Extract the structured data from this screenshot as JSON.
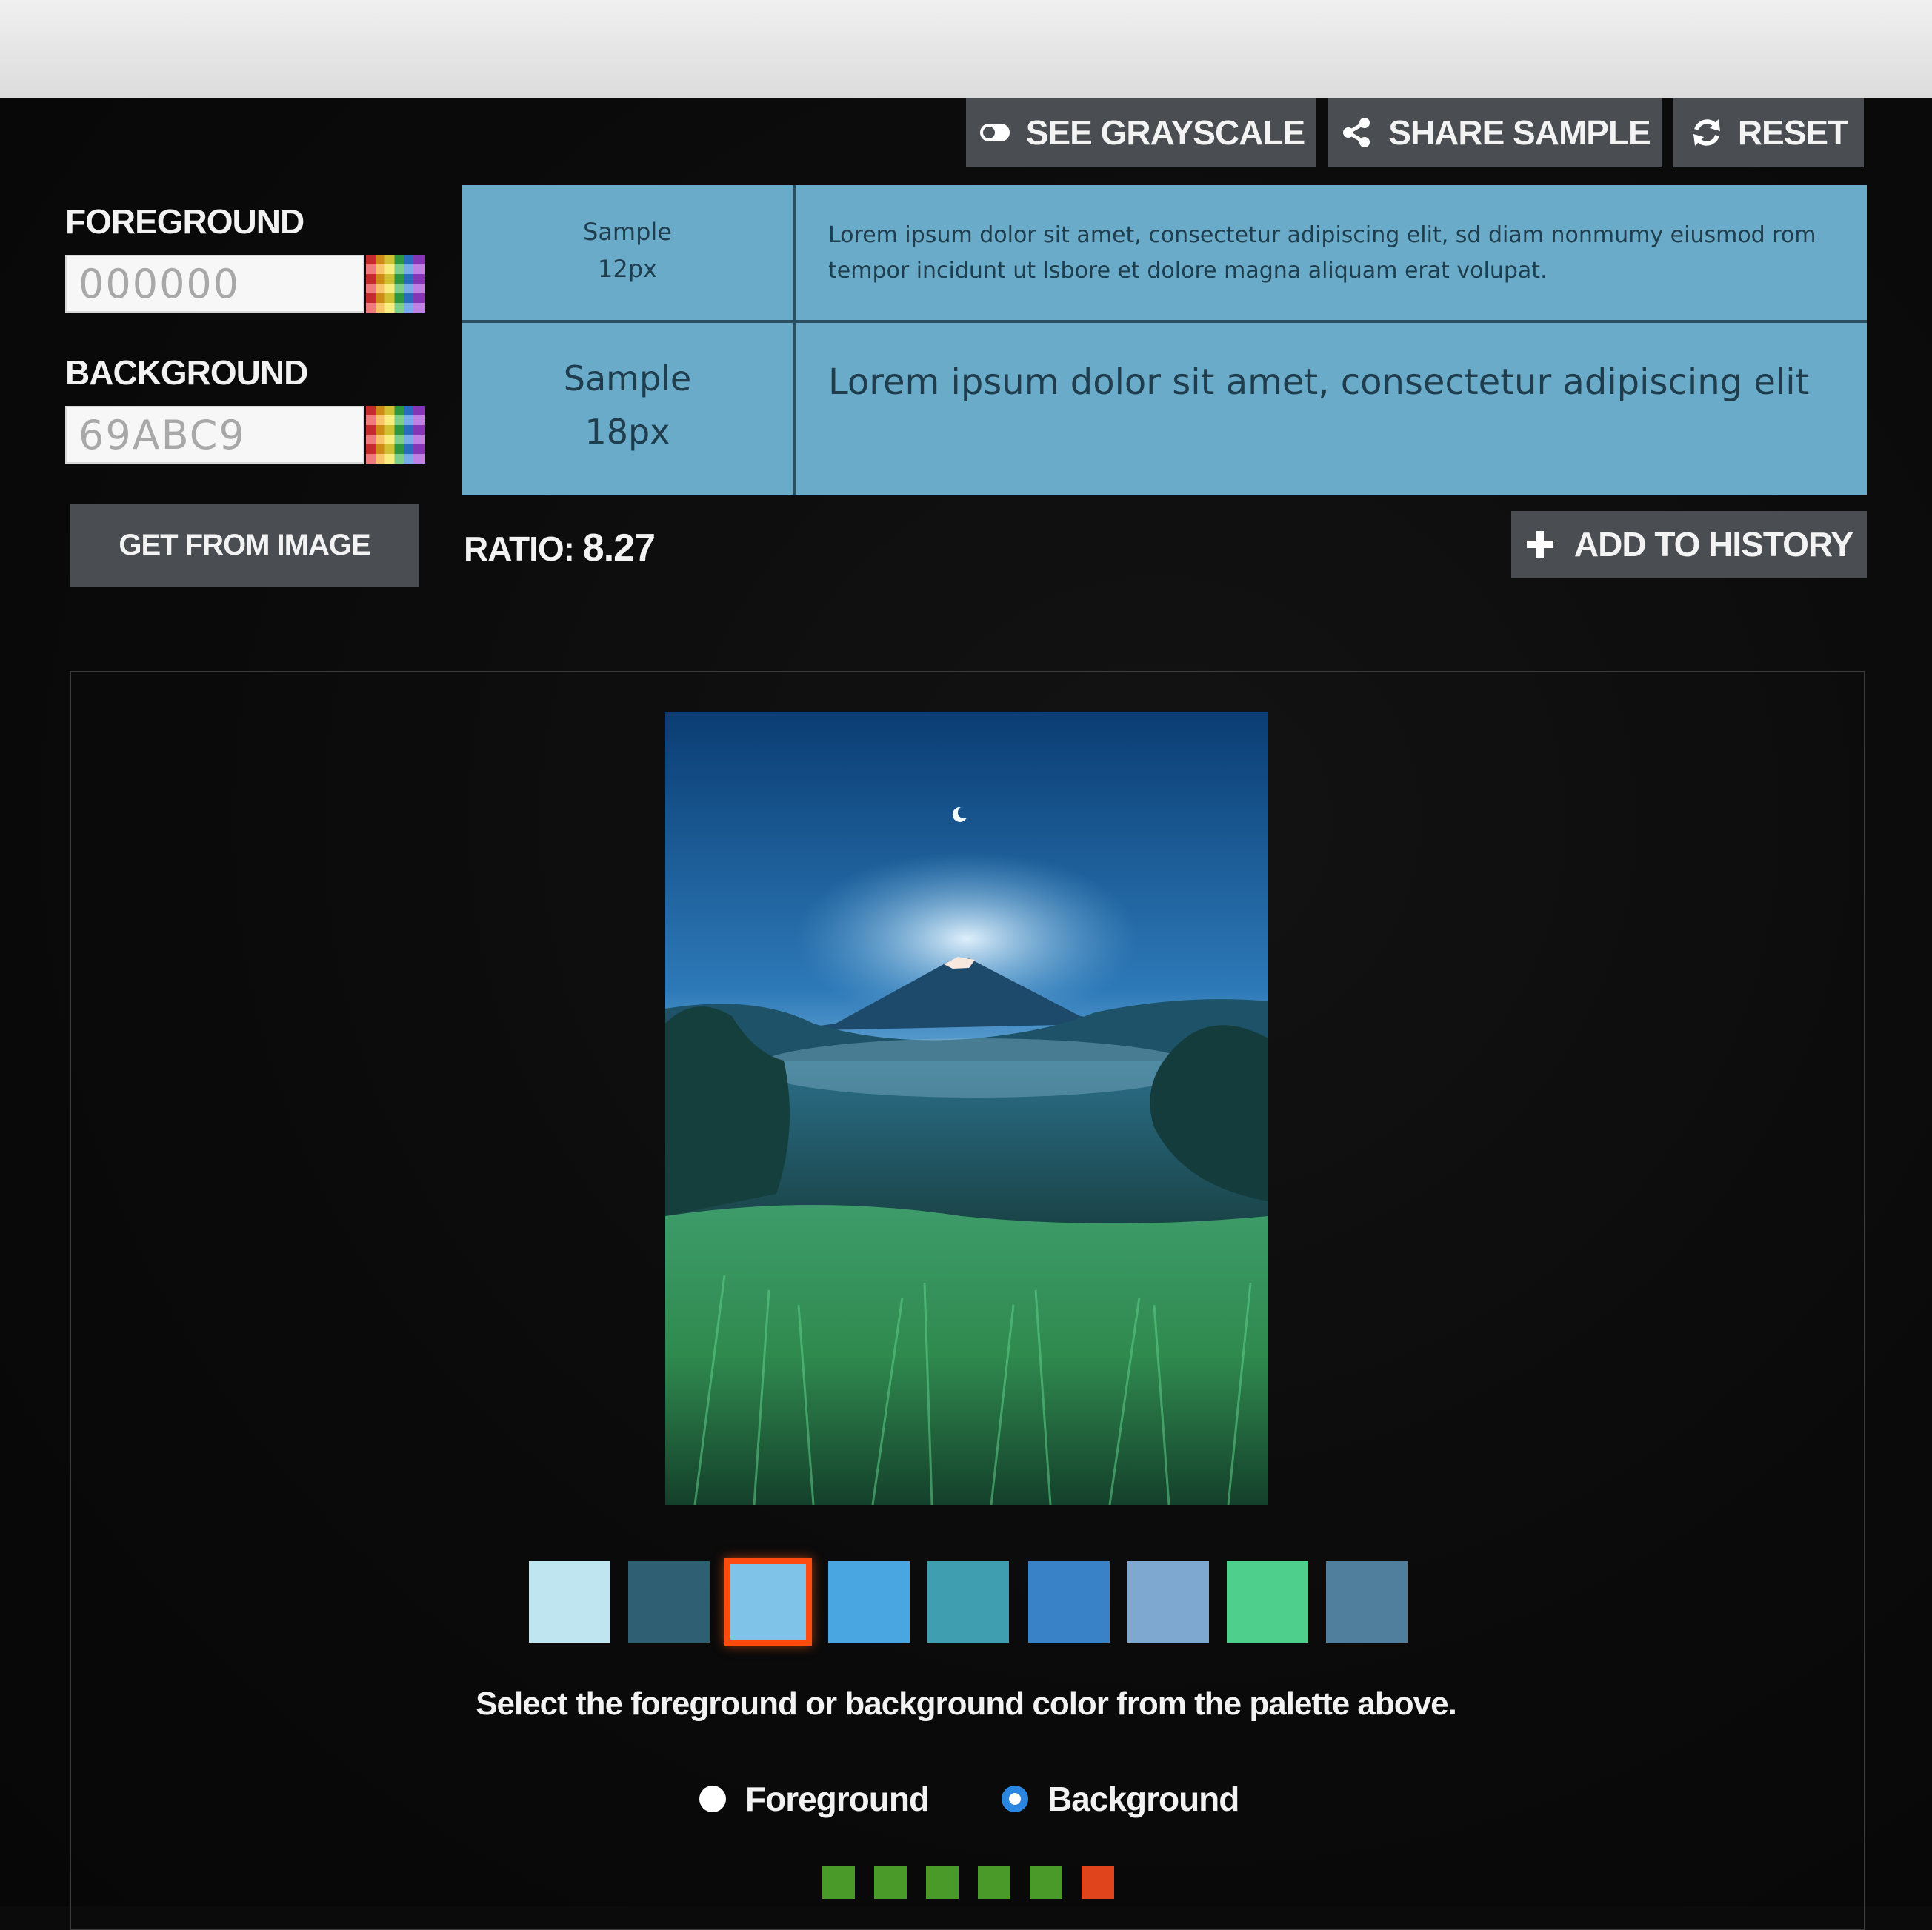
{
  "toolbar": {
    "grayscale_label": "SEE GRAYSCALE",
    "share_label": "SHARE SAMPLE",
    "reset_label": "RESET"
  },
  "colors": {
    "foreground_label": "FOREGROUND",
    "foreground_value": "000000",
    "background_label": "BACKGROUND",
    "background_value": "69ABC9",
    "get_from_image_label": "GET FROM IMAGE"
  },
  "sample": {
    "small_label_line1": "Sample",
    "small_label_line2": "12px",
    "large_label_line1": "Sample",
    "large_label_line2": "18px",
    "small_text": "Lorem ipsum dolor sit amet, consectetur adipiscing elit, sd diam nonmumy eiusmod rom tempor incidunt ut lsbore et dolore magna aliquam erat volupat.",
    "large_text": "Lorem ipsum dolor sit amet, consectetur adipiscing elit",
    "background_color": "#69ABC9",
    "text_color": "#000000"
  },
  "ratio": {
    "label": "RATIO:",
    "value": "8.27"
  },
  "history": {
    "add_label": "ADD TO HISTORY"
  },
  "palette": {
    "swatches": [
      "#bfe6f0",
      "#2f5f72",
      "#7fc3e8",
      "#4aa6e0",
      "#3f9fb0",
      "#3a82c8",
      "#7ea8d0",
      "#4fcf8c",
      "#4f7f9c"
    ],
    "selected_index": 2,
    "instruction": "Select the foreground or background color from the palette above.",
    "target_options": [
      {
        "label": "Foreground",
        "checked": false
      },
      {
        "label": "Background",
        "checked": true
      }
    ]
  },
  "indicators": [
    "#4a9a2a",
    "#4a9a2a",
    "#4a9a2a",
    "#4a9a2a",
    "#4a9a2a",
    "#e0441c"
  ]
}
